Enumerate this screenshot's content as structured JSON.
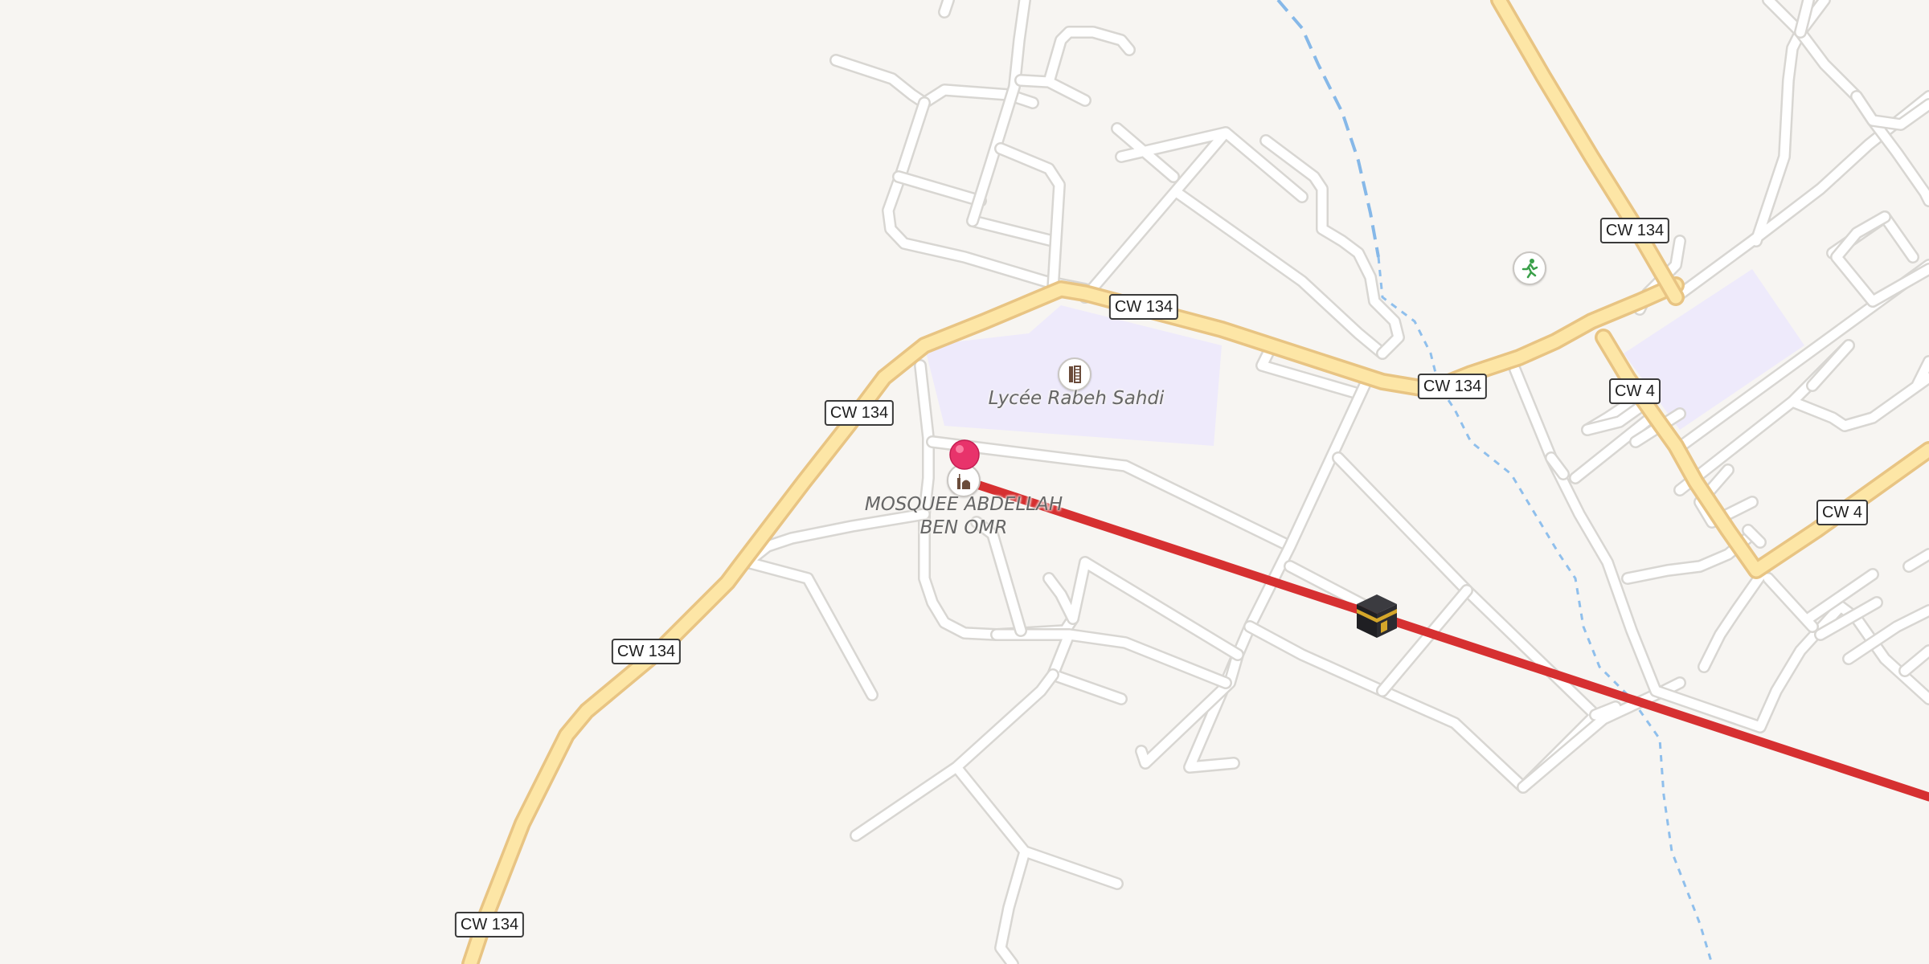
{
  "map": {
    "road_shields": [
      {
        "id": "cw134-top-right",
        "label": "CW 134"
      },
      {
        "id": "cw134-upper-mid",
        "label": "CW 134"
      },
      {
        "id": "cw134-right-mid",
        "label": "CW 134"
      },
      {
        "id": "cw134-left",
        "label": "CW 134"
      },
      {
        "id": "cw134-lower-left",
        "label": "CW 134"
      },
      {
        "id": "cw134-bottom",
        "label": "CW 134"
      },
      {
        "id": "cw4-upper",
        "label": "CW 4"
      },
      {
        "id": "cw4-right",
        "label": "CW 4"
      }
    ],
    "pois": {
      "school": {
        "name": "Lycée Rabeh Sahdi",
        "icon": "school-icon"
      },
      "mosque": {
        "name_line1": "MOSQUEE ABDELLAH",
        "name_line2": "BEN OMR",
        "icon": "mosque-icon"
      },
      "sports": {
        "icon": "running-person-icon"
      }
    },
    "markers": {
      "origin": {
        "icon": "map-pin-icon",
        "color": "#e8336b"
      },
      "destination": {
        "icon": "kaaba-icon"
      }
    },
    "route": {
      "color": "#d63031"
    },
    "colors": {
      "background": "#f7f5f2",
      "primary_road": "#fde6a6",
      "landuse": "#eeeafb",
      "water": "#86b8e8"
    }
  }
}
